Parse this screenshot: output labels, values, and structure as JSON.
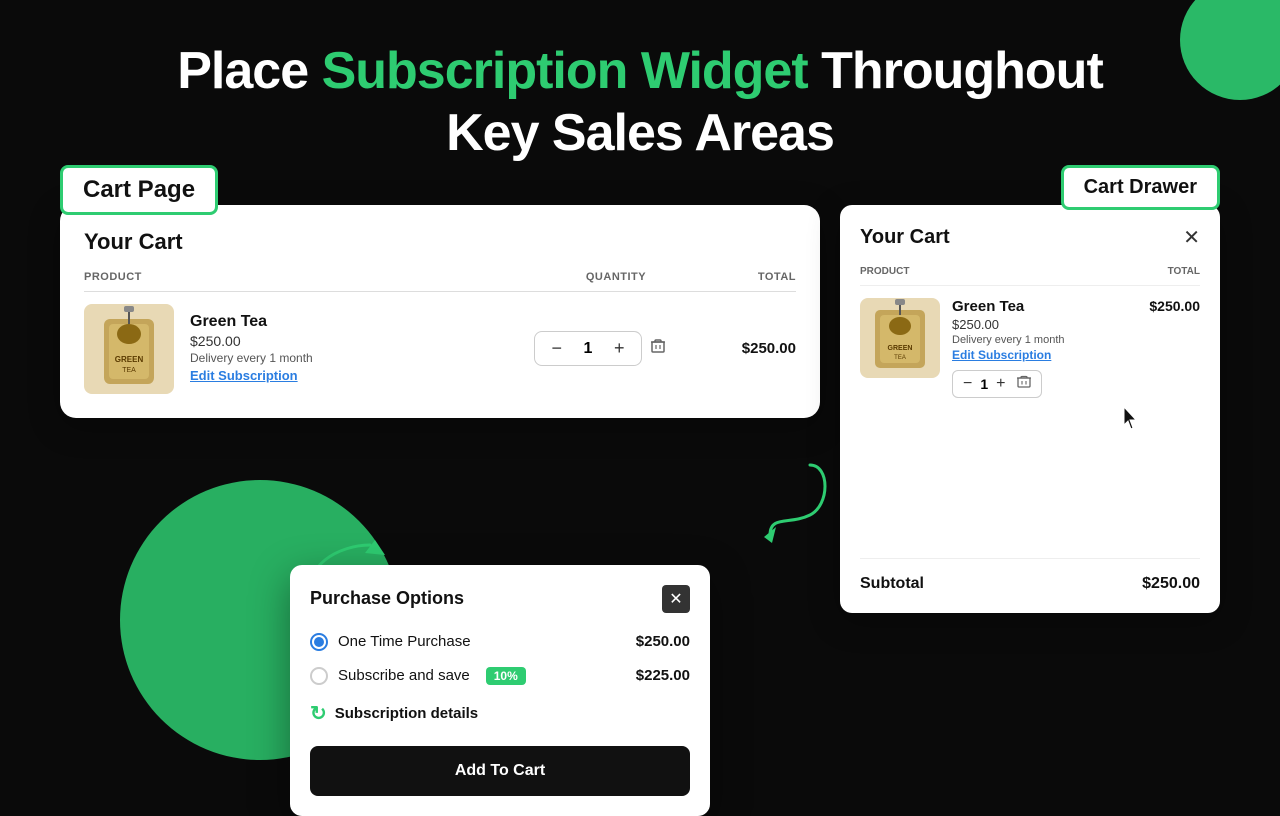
{
  "heading": {
    "line1_plain": "Place ",
    "line1_highlight": "Subscription Widget",
    "line1_plain2": " Throughout",
    "line2": "Key Sales Areas"
  },
  "cart_page_label": "Cart Page",
  "cart_drawer_label": "Cart Drawer",
  "cart_panel": {
    "title": "Your Cart",
    "columns": {
      "product": "Product",
      "quantity": "Quantity",
      "total": "Total"
    },
    "item": {
      "name": "Green Tea",
      "price": "$250.00",
      "delivery": "Delivery every 1 month",
      "edit_link": "Edit Subscription",
      "quantity": "1",
      "item_total": "$250.00"
    }
  },
  "purchase_modal": {
    "title": "Purchase Options",
    "options": [
      {
        "label": "One Time Purchase",
        "price": "$250.00",
        "selected": true,
        "badge": null
      },
      {
        "label": "Subscribe and save",
        "price": "$225.00",
        "selected": false,
        "badge": "10%"
      }
    ],
    "subscription_details": "Subscription details",
    "add_to_cart": "Add To Cart"
  },
  "cart_drawer": {
    "title": "Your Cart",
    "columns": {
      "product": "Product",
      "total": "Total"
    },
    "item": {
      "name": "Green Tea",
      "price": "$250.00",
      "delivery": "Delivery every 1 month",
      "edit_link": "Edit Subscription",
      "quantity": "1",
      "item_total": "$250.00"
    },
    "subtotal_label": "Subtotal",
    "subtotal_value": "$250.00"
  },
  "colors": {
    "green": "#2ecc71",
    "dark": "#111111",
    "blue_link": "#2a7de1"
  }
}
